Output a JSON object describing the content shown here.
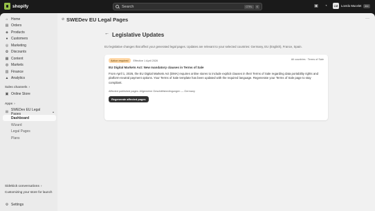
{
  "topbar": {
    "logo_text": "shopify",
    "search_placeholder": "Search",
    "shortcut_keys": [
      "CTRL",
      "K"
    ],
    "icons": [
      "store-icon",
      "bell-icon"
    ],
    "user": {
      "initials": "LM",
      "name": "Lovrdo Mucelet",
      "badge": "dev"
    }
  },
  "sidebar": {
    "items": [
      {
        "label": "Home",
        "icon": "home-icon"
      },
      {
        "label": "Orders",
        "icon": "orders-icon"
      },
      {
        "label": "Products",
        "icon": "products-icon"
      },
      {
        "label": "Customers",
        "icon": "customers-icon"
      },
      {
        "label": "Marketing",
        "icon": "marketing-icon"
      },
      {
        "label": "Discounts",
        "icon": "discounts-icon"
      },
      {
        "label": "Content",
        "icon": "content-icon"
      },
      {
        "label": "Markets",
        "icon": "markets-icon"
      },
      {
        "label": "Finance",
        "icon": "finance-icon"
      },
      {
        "label": "Analytics",
        "icon": "analytics-icon"
      }
    ],
    "sales_channels_label": "Sales channels",
    "online_store": "Online Store",
    "apps_label": "Apps",
    "app_name": "SWEDev EU Legal Pages",
    "app_subitems": [
      "Dashboard",
      "Wizard",
      "Legal Pages",
      "Plans"
    ],
    "sidekick_label": "Sidekick conversations",
    "sidekick_item": "Customizing your store for launch",
    "settings": "Settings"
  },
  "main": {
    "app_title": "SWEDev EU Legal Pages",
    "page_title": "Legislative Updates",
    "intro": "EU legislative changes that affect your generated legal pages. Updates are relevant to your selected countries: Germany, EU (English), France, Spain.",
    "card": {
      "badge": "Action required",
      "effective": "Effective 1 April 2026",
      "scope": "All countries · Terms of Sale",
      "title": "EU Digital Markets Act: New mandatory clauses in Terms of Sale",
      "body": "From April 1, 2026, the EU Digital Markets Act (DMA) requires online stores to include explicit clauses in their Terms of Sale regarding data portability rights and platform-neutral payment options. Your Terms of Sale template has been updated with the required language. Regenerate your Terms of Sale page to stay compliant.",
      "affected": "Affected published pages: Allgemeine Geschäftsbedingungen — Germany",
      "button": "Regenerate affected pages"
    }
  },
  "colors": {
    "topbar_bg": "#1a1a1a",
    "sidebar_bg": "#ebebeb",
    "main_bg": "#f1f1f1",
    "badge_bg": "#ffd6a4",
    "logo_green": "#95bf47"
  }
}
